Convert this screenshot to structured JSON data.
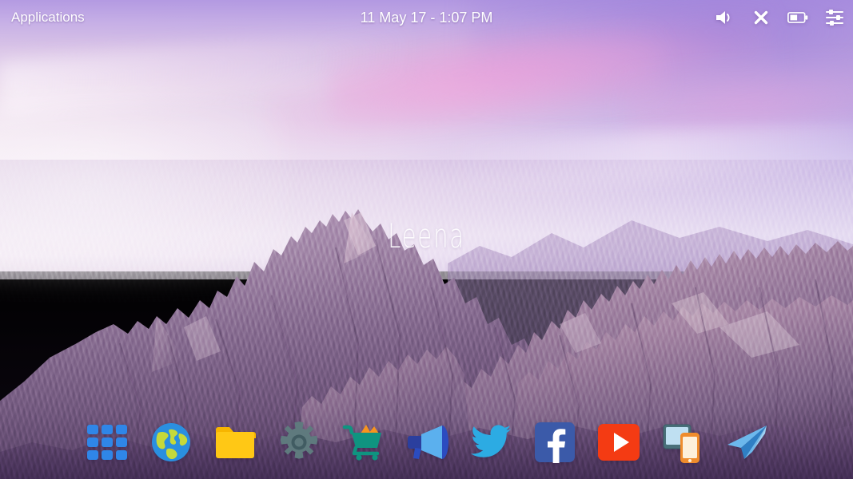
{
  "desktop": {
    "watermark": "Leena",
    "wallpaper_name": "purple-mountain-sunset-wallpaper",
    "colors": {
      "sky_top_right": "#9e86dd",
      "sky_left": "#f5ecf3",
      "cloud_pink": "#ee96d7",
      "rock_light": "#c6a6bf",
      "rock_mid": "#a07fa0",
      "rock_dark": "#6b4f77",
      "text_white": "#ffffff"
    }
  },
  "topbar": {
    "applications_label": "Applications",
    "clock": "11 May 17 - 1:07 PM",
    "tray": [
      {
        "name": "volume-icon",
        "label": "Volume",
        "glyph": "speaker"
      },
      {
        "name": "close-icon",
        "label": "Close",
        "glyph": "x"
      },
      {
        "name": "battery-icon",
        "label": "Battery",
        "glyph": "battery",
        "level_percent": 50
      },
      {
        "name": "settings-sliders-icon",
        "label": "Settings",
        "glyph": "sliders"
      }
    ]
  },
  "dock": {
    "items": [
      {
        "name": "dock-item-app-grid",
        "label": "Applications Grid",
        "icon": "app-grid-icon"
      },
      {
        "name": "dock-item-browser",
        "label": "Browser",
        "icon": "globe-icon"
      },
      {
        "name": "dock-item-files",
        "label": "Files",
        "icon": "folder-icon"
      },
      {
        "name": "dock-item-settings",
        "label": "Settings",
        "icon": "gear-icon"
      },
      {
        "name": "dock-item-store",
        "label": "Store",
        "icon": "shopping-cart-icon"
      },
      {
        "name": "dock-item-announce",
        "label": "Announcements",
        "icon": "megaphone-icon"
      },
      {
        "name": "dock-item-twitter",
        "label": "Twitter",
        "icon": "twitter-bird-icon"
      },
      {
        "name": "dock-item-facebook",
        "label": "Facebook",
        "icon": "facebook-icon"
      },
      {
        "name": "dock-item-youtube",
        "label": "YouTube",
        "icon": "youtube-icon"
      },
      {
        "name": "dock-item-devices",
        "label": "Devices",
        "icon": "tablet-phone-icon"
      },
      {
        "name": "dock-item-telegram",
        "label": "Telegram",
        "icon": "paper-plane-icon"
      }
    ]
  }
}
